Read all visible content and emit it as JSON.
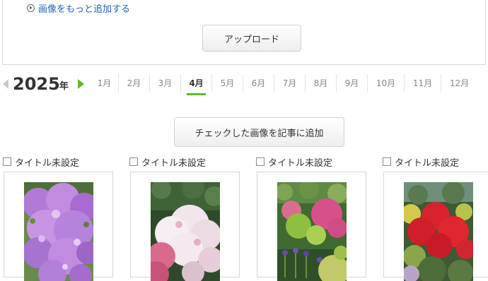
{
  "upload": {
    "add_more_label": "画像をもっと追加する",
    "upload_button": "アップロード"
  },
  "calendar": {
    "year": "2025",
    "year_suffix": "年",
    "months": [
      "1月",
      "2月",
      "3月",
      "4月",
      "5月",
      "6月",
      "7月",
      "8月",
      "9月",
      "10月",
      "11月",
      "12月"
    ],
    "active_month": "4月",
    "accent_color": "#5dbb2a"
  },
  "actions": {
    "add_checked_button": "チェックした画像を記事に追加"
  },
  "images": [
    {
      "title": "タイトル未設定",
      "checked": false,
      "subject": "purple azalea bush"
    },
    {
      "title": "タイトル未設定",
      "checked": false,
      "subject": "white and pink azaleas"
    },
    {
      "title": "タイトル未設定",
      "checked": false,
      "subject": "pink azaleas with iris"
    },
    {
      "title": "タイトル未設定",
      "checked": false,
      "subject": "red azaleas in garden"
    }
  ],
  "link_color": "#1f63b6"
}
